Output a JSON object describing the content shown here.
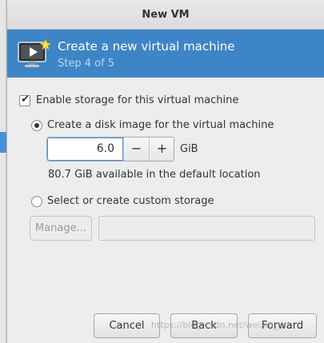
{
  "window": {
    "title": "New VM"
  },
  "banner": {
    "title": "Create a new virtual machine",
    "step": "Step 4 of 5",
    "icon": "monitor-play-icon"
  },
  "storage": {
    "enable_label": "Enable storage for this virtual machine",
    "enable_checked": true,
    "create_disk_label": "Create a disk image for the virtual machine",
    "disk_size": "6.0",
    "disk_unit": "GiB",
    "decrement": "−",
    "increment": "+",
    "available_text": "80.7 GiB available in the default location",
    "custom_label": "Select or create custom storage",
    "manage_label": "Manage..."
  },
  "footer": {
    "cancel_label": "Cancel",
    "back_label": "Back",
    "forward_label": "Forward"
  },
  "watermark": "https://blog.csdn.net/weixin_...",
  "colors": {
    "banner": "#3d85c6",
    "focus": "#4a90d9"
  }
}
